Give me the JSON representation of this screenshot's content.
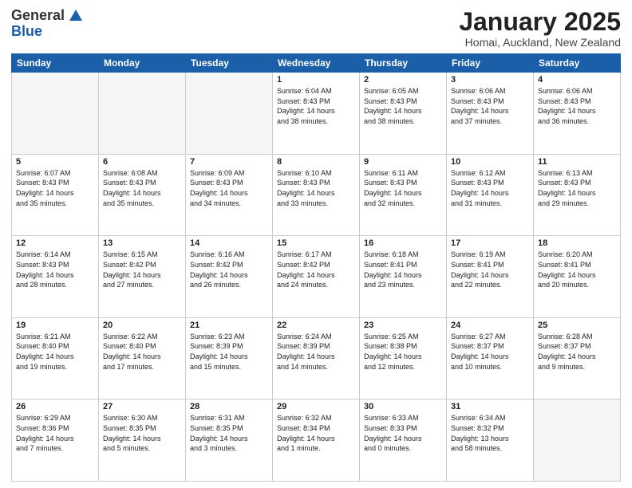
{
  "header": {
    "logo_general": "General",
    "logo_blue": "Blue",
    "title": "January 2025",
    "location": "Homai, Auckland, New Zealand"
  },
  "days_of_week": [
    "Sunday",
    "Monday",
    "Tuesday",
    "Wednesday",
    "Thursday",
    "Friday",
    "Saturday"
  ],
  "weeks": [
    [
      {
        "num": "",
        "info": ""
      },
      {
        "num": "",
        "info": ""
      },
      {
        "num": "",
        "info": ""
      },
      {
        "num": "1",
        "info": "Sunrise: 6:04 AM\nSunset: 8:43 PM\nDaylight: 14 hours\nand 38 minutes."
      },
      {
        "num": "2",
        "info": "Sunrise: 6:05 AM\nSunset: 8:43 PM\nDaylight: 14 hours\nand 38 minutes."
      },
      {
        "num": "3",
        "info": "Sunrise: 6:06 AM\nSunset: 8:43 PM\nDaylight: 14 hours\nand 37 minutes."
      },
      {
        "num": "4",
        "info": "Sunrise: 6:06 AM\nSunset: 8:43 PM\nDaylight: 14 hours\nand 36 minutes."
      }
    ],
    [
      {
        "num": "5",
        "info": "Sunrise: 6:07 AM\nSunset: 8:43 PM\nDaylight: 14 hours\nand 35 minutes."
      },
      {
        "num": "6",
        "info": "Sunrise: 6:08 AM\nSunset: 8:43 PM\nDaylight: 14 hours\nand 35 minutes."
      },
      {
        "num": "7",
        "info": "Sunrise: 6:09 AM\nSunset: 8:43 PM\nDaylight: 14 hours\nand 34 minutes."
      },
      {
        "num": "8",
        "info": "Sunrise: 6:10 AM\nSunset: 8:43 PM\nDaylight: 14 hours\nand 33 minutes."
      },
      {
        "num": "9",
        "info": "Sunrise: 6:11 AM\nSunset: 8:43 PM\nDaylight: 14 hours\nand 32 minutes."
      },
      {
        "num": "10",
        "info": "Sunrise: 6:12 AM\nSunset: 8:43 PM\nDaylight: 14 hours\nand 31 minutes."
      },
      {
        "num": "11",
        "info": "Sunrise: 6:13 AM\nSunset: 8:43 PM\nDaylight: 14 hours\nand 29 minutes."
      }
    ],
    [
      {
        "num": "12",
        "info": "Sunrise: 6:14 AM\nSunset: 8:43 PM\nDaylight: 14 hours\nand 28 minutes."
      },
      {
        "num": "13",
        "info": "Sunrise: 6:15 AM\nSunset: 8:42 PM\nDaylight: 14 hours\nand 27 minutes."
      },
      {
        "num": "14",
        "info": "Sunrise: 6:16 AM\nSunset: 8:42 PM\nDaylight: 14 hours\nand 26 minutes."
      },
      {
        "num": "15",
        "info": "Sunrise: 6:17 AM\nSunset: 8:42 PM\nDaylight: 14 hours\nand 24 minutes."
      },
      {
        "num": "16",
        "info": "Sunrise: 6:18 AM\nSunset: 8:41 PM\nDaylight: 14 hours\nand 23 minutes."
      },
      {
        "num": "17",
        "info": "Sunrise: 6:19 AM\nSunset: 8:41 PM\nDaylight: 14 hours\nand 22 minutes."
      },
      {
        "num": "18",
        "info": "Sunrise: 6:20 AM\nSunset: 8:41 PM\nDaylight: 14 hours\nand 20 minutes."
      }
    ],
    [
      {
        "num": "19",
        "info": "Sunrise: 6:21 AM\nSunset: 8:40 PM\nDaylight: 14 hours\nand 19 minutes."
      },
      {
        "num": "20",
        "info": "Sunrise: 6:22 AM\nSunset: 8:40 PM\nDaylight: 14 hours\nand 17 minutes."
      },
      {
        "num": "21",
        "info": "Sunrise: 6:23 AM\nSunset: 8:39 PM\nDaylight: 14 hours\nand 15 minutes."
      },
      {
        "num": "22",
        "info": "Sunrise: 6:24 AM\nSunset: 8:39 PM\nDaylight: 14 hours\nand 14 minutes."
      },
      {
        "num": "23",
        "info": "Sunrise: 6:25 AM\nSunset: 8:38 PM\nDaylight: 14 hours\nand 12 minutes."
      },
      {
        "num": "24",
        "info": "Sunrise: 6:27 AM\nSunset: 8:37 PM\nDaylight: 14 hours\nand 10 minutes."
      },
      {
        "num": "25",
        "info": "Sunrise: 6:28 AM\nSunset: 8:37 PM\nDaylight: 14 hours\nand 9 minutes."
      }
    ],
    [
      {
        "num": "26",
        "info": "Sunrise: 6:29 AM\nSunset: 8:36 PM\nDaylight: 14 hours\nand 7 minutes."
      },
      {
        "num": "27",
        "info": "Sunrise: 6:30 AM\nSunset: 8:35 PM\nDaylight: 14 hours\nand 5 minutes."
      },
      {
        "num": "28",
        "info": "Sunrise: 6:31 AM\nSunset: 8:35 PM\nDaylight: 14 hours\nand 3 minutes."
      },
      {
        "num": "29",
        "info": "Sunrise: 6:32 AM\nSunset: 8:34 PM\nDaylight: 14 hours\nand 1 minute."
      },
      {
        "num": "30",
        "info": "Sunrise: 6:33 AM\nSunset: 8:33 PM\nDaylight: 14 hours\nand 0 minutes."
      },
      {
        "num": "31",
        "info": "Sunrise: 6:34 AM\nSunset: 8:32 PM\nDaylight: 13 hours\nand 58 minutes."
      },
      {
        "num": "",
        "info": ""
      }
    ]
  ]
}
